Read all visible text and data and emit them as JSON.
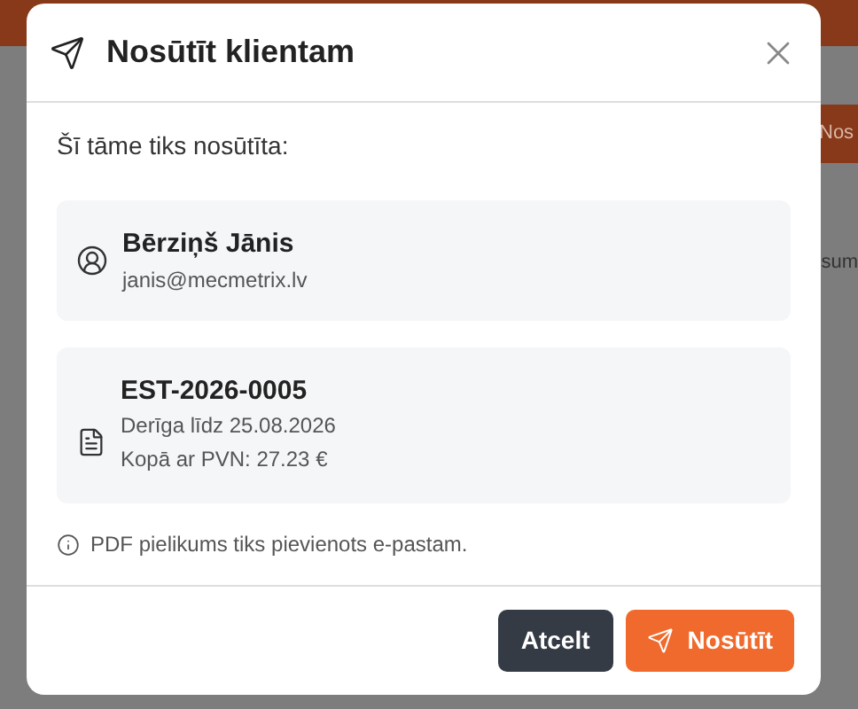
{
  "background": {
    "button_label": "Nos",
    "column_text": "sum"
  },
  "dialog": {
    "title": "Nosūtīt klientam",
    "intro": "Šī tāme tiks nosūtīta:",
    "client": {
      "name": "Bērziņš Jānis",
      "email": "janis@mecmetrix.lv"
    },
    "estimate": {
      "number": "EST-2026-0005",
      "valid_until": "Derīga līdz 25.08.2026",
      "total": "Kopā ar PVN: 27.23 €"
    },
    "note": "PDF pielikums tiks pievienots e-pastam.",
    "buttons": [
      {
        "kind": "secondary",
        "label": "Atcelt"
      },
      {
        "kind": "primary",
        "label": "Nosūtīt"
      }
    ]
  }
}
